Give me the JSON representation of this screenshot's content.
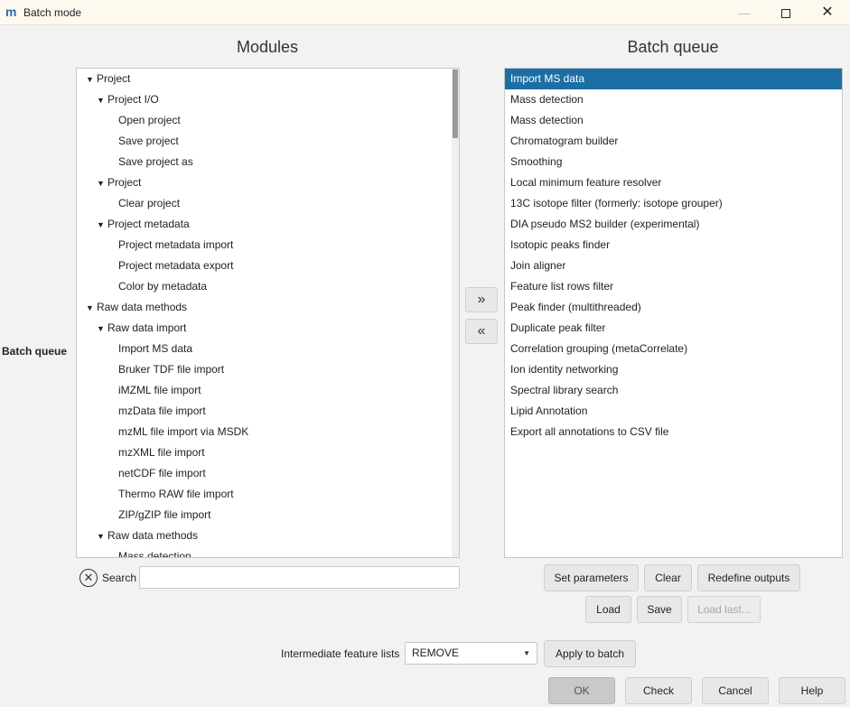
{
  "window": {
    "title": "Batch mode",
    "app_icon": "mzmine-logo",
    "minimize_glyph": "—",
    "close_glyph": "✕"
  },
  "modules_title": "Modules",
  "queue_title": "Batch queue",
  "side_label": "Batch queue",
  "tree": [
    {
      "label": "Project",
      "level": 0,
      "expanded": true
    },
    {
      "label": "Project I/O",
      "level": 1,
      "expanded": true
    },
    {
      "label": "Open project",
      "level": 2
    },
    {
      "label": "Save project",
      "level": 2
    },
    {
      "label": "Save project as",
      "level": 2
    },
    {
      "label": "Project",
      "level": 1,
      "expanded": true
    },
    {
      "label": "Clear project",
      "level": 2
    },
    {
      "label": "Project metadata",
      "level": 1,
      "expanded": true
    },
    {
      "label": "Project metadata import",
      "level": 2
    },
    {
      "label": "Project metadata export",
      "level": 2
    },
    {
      "label": "Color by metadata",
      "level": 2
    },
    {
      "label": "Raw data methods",
      "level": 0,
      "expanded": true
    },
    {
      "label": "Raw data import",
      "level": 1,
      "expanded": true
    },
    {
      "label": "Import MS data",
      "level": 2
    },
    {
      "label": "Bruker TDF file import",
      "level": 2
    },
    {
      "label": "iMZML file import",
      "level": 2
    },
    {
      "label": "mzData file import",
      "level": 2
    },
    {
      "label": "mzML file import via MSDK",
      "level": 2
    },
    {
      "label": "mzXML file import",
      "level": 2
    },
    {
      "label": "netCDF file import",
      "level": 2
    },
    {
      "label": "Thermo RAW file import",
      "level": 2
    },
    {
      "label": "ZIP/gZIP file import",
      "level": 2
    },
    {
      "label": "Raw data methods",
      "level": 1,
      "expanded": true
    },
    {
      "label": "Mass detection",
      "level": 2
    }
  ],
  "queue": [
    "Import MS data",
    "Mass detection",
    "Mass detection",
    "Chromatogram builder",
    "Smoothing",
    "Local minimum feature resolver",
    "13C isotope filter (formerly: isotope grouper)",
    "DIA pseudo MS2 builder (experimental)",
    "Isotopic peaks finder",
    "Join aligner",
    "Feature list rows filter",
    "Peak finder (multithreaded)",
    "Duplicate peak filter",
    "Correlation grouping (metaCorrelate)",
    "Ion identity networking",
    "Spectral library search",
    "Lipid Annotation",
    "Export all annotations to CSV file"
  ],
  "queue_selected_index": 0,
  "add_glyph": "»",
  "remove_glyph": "«",
  "search": {
    "label": "Search",
    "value": "",
    "clear_glyph": "✕"
  },
  "buttons": {
    "set_parameters": "Set parameters",
    "clear": "Clear",
    "redefine_outputs": "Redefine outputs",
    "load": "Load",
    "save": "Save",
    "load_last": "Load last...",
    "apply_to_batch": "Apply to batch",
    "ok": "OK",
    "check": "Check",
    "cancel": "Cancel",
    "help": "Help"
  },
  "intermediate": {
    "label": "Intermediate feature lists",
    "value": "REMOVE"
  },
  "colors": {
    "selection": "#1c6ea4",
    "title_bar": "#fdf9ee"
  }
}
